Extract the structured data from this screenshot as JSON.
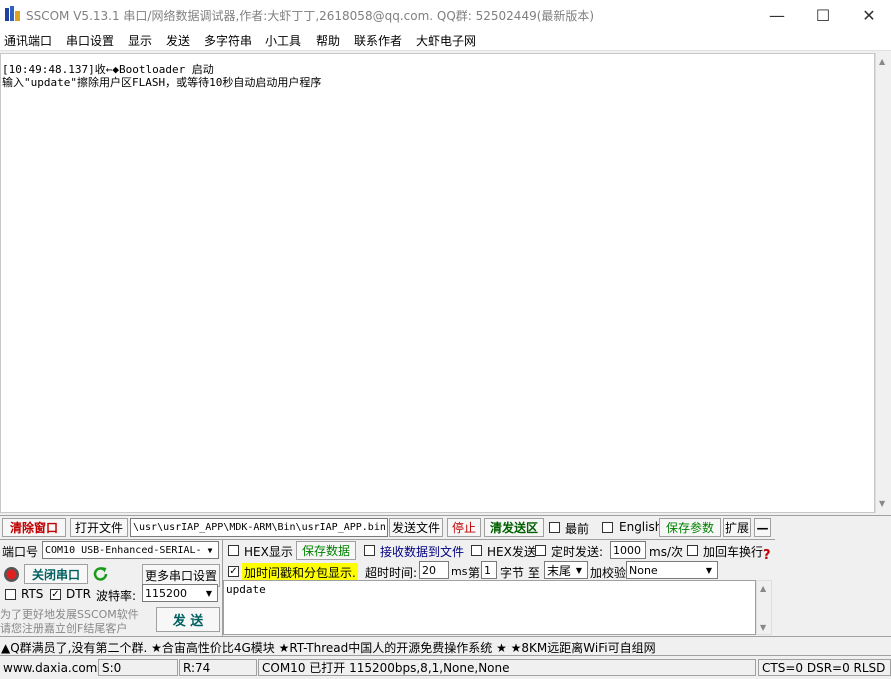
{
  "window": {
    "title": "SSCOM V5.13.1 串口/网络数据调试器,作者:大虾丁丁,2618058@qq.com. QQ群: 52502449(最新版本)",
    "minimize": "—",
    "maximize": "☐",
    "close": "✕"
  },
  "menu": [
    "通讯端口",
    "串口设置",
    "显示",
    "发送",
    "多字符串",
    "小工具",
    "帮助",
    "联系作者",
    "大虾电子网"
  ],
  "receive": {
    "lines": [
      "[10:49:48.137]收←◆Bootloader 启动",
      "输入\"update\"擦除用户区FLASH，或等待10秒自动启动用户程序"
    ]
  },
  "toolbar": {
    "clear_window": "清除窗口",
    "open_file": "打开文件",
    "file_path": "\\usr\\usrIAP_APP\\MDK-ARM\\Bin\\usrIAP_APP.bin",
    "send_file": "发送文件",
    "stop": "停止",
    "clear_send": "清发送区",
    "topmost": "最前",
    "english": "English",
    "save_params": "保存参数",
    "expand": "扩展",
    "collapse": "—"
  },
  "port": {
    "port_label": "端口号",
    "port_value": "COM10 USB-Enhanced-SERIAL-",
    "close_port": "关闭串口",
    "more_settings": "更多串口设置",
    "rts": "RTS",
    "dtr": "DTR",
    "baud_label": "波特率:",
    "baud_value": "115200",
    "rts_checked": false,
    "dtr_checked": true
  },
  "options": {
    "hex_display": "HEX显示",
    "save_data": "保存数据",
    "recv_to_file": "接收数据到文件",
    "hex_send": "HEX发送",
    "timed_send": "定时发送:",
    "interval_value": "1000",
    "interval_unit": "ms/次",
    "add_crlf": "加回车换行",
    "timestamp": "加时间戳和分包显示.",
    "timestamp_checked": true,
    "timeout_label": "超时时间:",
    "timeout_value": "20",
    "timeout_unit": "ms",
    "nth_label": "第",
    "nth_value": "1",
    "byte_label": "字节 至",
    "to_value": "末尾",
    "checksum_label": "加校验",
    "checksum_value": "None"
  },
  "send": {
    "text": "update",
    "send_button": "发 送",
    "promo_line1": "为了更好地发展SSCOM软件",
    "promo_line2": "请您注册嘉立创F结尾客户"
  },
  "ticker": "▲Q群满员了,没有第二个群. ★合宙高性价比4G模块 ★RT-Thread中国人的开源免费操作系统 ★ ★8KM远距离WiFi可自组网",
  "status": {
    "site": "www.daxia.com",
    "sent": "S:0",
    "received": "R:74",
    "port_state": "COM10 已打开  115200bps,8,1,None,None",
    "signals": "CTS=0 DSR=0 RLSD"
  }
}
